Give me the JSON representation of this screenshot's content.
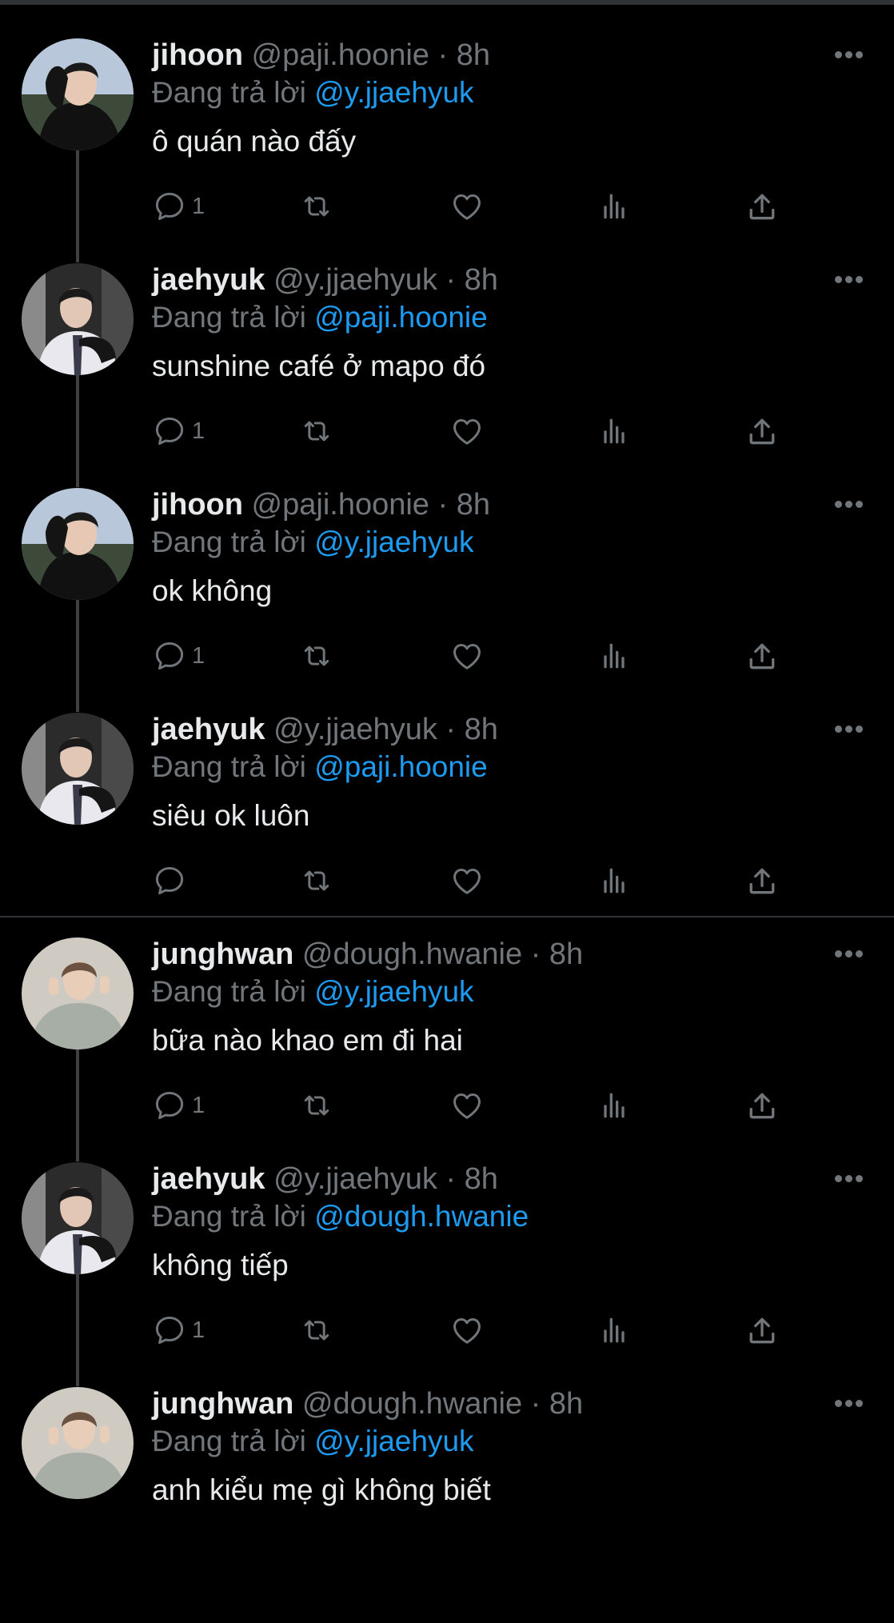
{
  "tweets": [
    {
      "name": "jihoon",
      "handle": "@paji.hoonie",
      "time": "· 8h",
      "reply_prefix": "Đang trả lời",
      "reply_to": "@y.jjaehyuk",
      "text": "ô quán nào đấy",
      "reply_count": "1",
      "avatar": "jihoon-avatar"
    },
    {
      "name": "jaehyuk",
      "handle": "@y.jjaehyuk",
      "time": "· 8h",
      "reply_prefix": "Đang trả lời",
      "reply_to": "@paji.hoonie",
      "text": "sunshine café ở mapo đó",
      "reply_count": "1",
      "avatar": "jaehyuk-avatar"
    },
    {
      "name": "jihoon",
      "handle": "@paji.hoonie",
      "time": "· 8h",
      "reply_prefix": "Đang trả lời",
      "reply_to": "@y.jjaehyuk",
      "text": "ok không",
      "reply_count": "1",
      "avatar": "jihoon-avatar"
    },
    {
      "name": "jaehyuk",
      "handle": "@y.jjaehyuk",
      "time": "· 8h",
      "reply_prefix": "Đang trả lời",
      "reply_to": "@paji.hoonie",
      "text": "siêu ok luôn",
      "reply_count": "",
      "avatar": "jaehyuk-avatar"
    },
    {
      "name": "junghwan",
      "handle": "@dough.hwanie",
      "time": "· 8h",
      "reply_prefix": "Đang trả lời",
      "reply_to": "@y.jjaehyuk",
      "text": "bữa nào khao em đi hai",
      "reply_count": "1",
      "avatar": "junghwan-avatar"
    },
    {
      "name": "jaehyuk",
      "handle": "@y.jjaehyuk",
      "time": "· 8h",
      "reply_prefix": "Đang trả lời",
      "reply_to": "@dough.hwanie",
      "text": "không tiếp",
      "reply_count": "1",
      "avatar": "jaehyuk-avatar"
    },
    {
      "name": "junghwan",
      "handle": "@dough.hwanie",
      "time": "· 8h",
      "reply_prefix": "Đang trả lời",
      "reply_to": "@y.jjaehyuk",
      "text": "anh kiểu mẹ gì không biết",
      "reply_count": "",
      "avatar": "junghwan-avatar"
    }
  ],
  "icons": {
    "reply": "reply-icon",
    "retweet": "retweet-icon",
    "like": "heart-icon",
    "views": "views-icon",
    "share": "share-icon",
    "more": "more-icon"
  },
  "colors": {
    "background": "#000000",
    "text": "#e7e9ea",
    "secondary": "#71767b",
    "mention": "#1d9bf0",
    "divider": "#2f3336",
    "thread_line": "#3e4144"
  }
}
